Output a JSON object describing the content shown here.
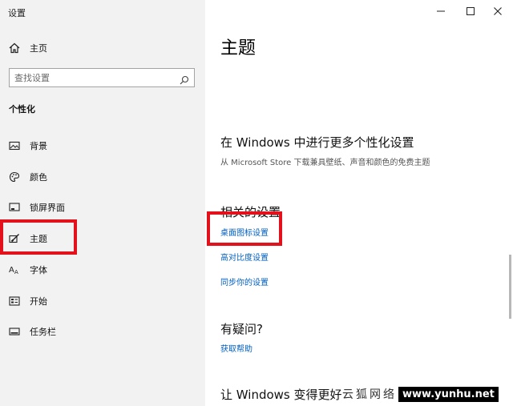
{
  "window": {
    "title": "设置",
    "minimize_icon": "minimize-icon",
    "maximize_icon": "maximize-icon",
    "close_icon": "close-icon"
  },
  "sidebar": {
    "home_label": "主页",
    "search_placeholder": "查找设置",
    "section": "个性化",
    "items": [
      {
        "label": "背景",
        "icon": "picture-icon"
      },
      {
        "label": "颜色",
        "icon": "palette-icon"
      },
      {
        "label": "锁屏界面",
        "icon": "lock-screen-icon"
      },
      {
        "label": "主题",
        "icon": "theme-brush-icon"
      },
      {
        "label": "字体",
        "icon": "font-icon"
      },
      {
        "label": "开始",
        "icon": "start-icon"
      },
      {
        "label": "任务栏",
        "icon": "taskbar-icon"
      }
    ]
  },
  "main": {
    "title": "主题",
    "more_heading": "在 Windows 中进行更多个性化设置",
    "more_desc": "从 Microsoft Store 下载兼具壁纸、声音和颜色的免费主题",
    "related_heading": "相关的设置",
    "related_links": [
      "桌面图标设置",
      "高对比度设置",
      "同步你的设置"
    ],
    "question_heading": "有疑问?",
    "help_link": "获取帮助",
    "improve_heading": "让 Windows 变得更好"
  },
  "watermark": {
    "text": "云狐网络",
    "url": "www.yunhu.net"
  },
  "colors": {
    "sidebar_bg": "#f2f2f2",
    "link": "#0060c0",
    "highlight_box": "#e3111b"
  }
}
